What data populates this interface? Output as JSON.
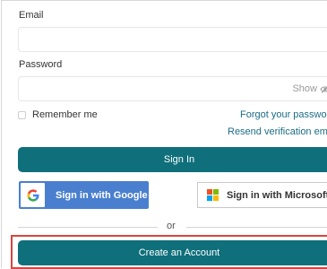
{
  "form": {
    "email_label": "Email",
    "email_value": "",
    "password_label": "Password",
    "password_value": "",
    "show_toggle": "Show",
    "remember_me": "Remember me",
    "forgot_password": "Forgot your password?",
    "resend_verification": "Resend verification email?",
    "sign_in": "Sign In",
    "google_button": "Sign in with Google",
    "microsoft_button": "Sign in with Microsoft",
    "divider_text": "or",
    "create_account": "Create an Account"
  },
  "colors": {
    "primary": "#0f6f7b",
    "link": "#1a6c86",
    "google_blue": "#4a7fcf",
    "highlight": "#d64541"
  },
  "icons": [
    "eye-slash-icon",
    "google-g-icon",
    "microsoft-logo-icon"
  ]
}
